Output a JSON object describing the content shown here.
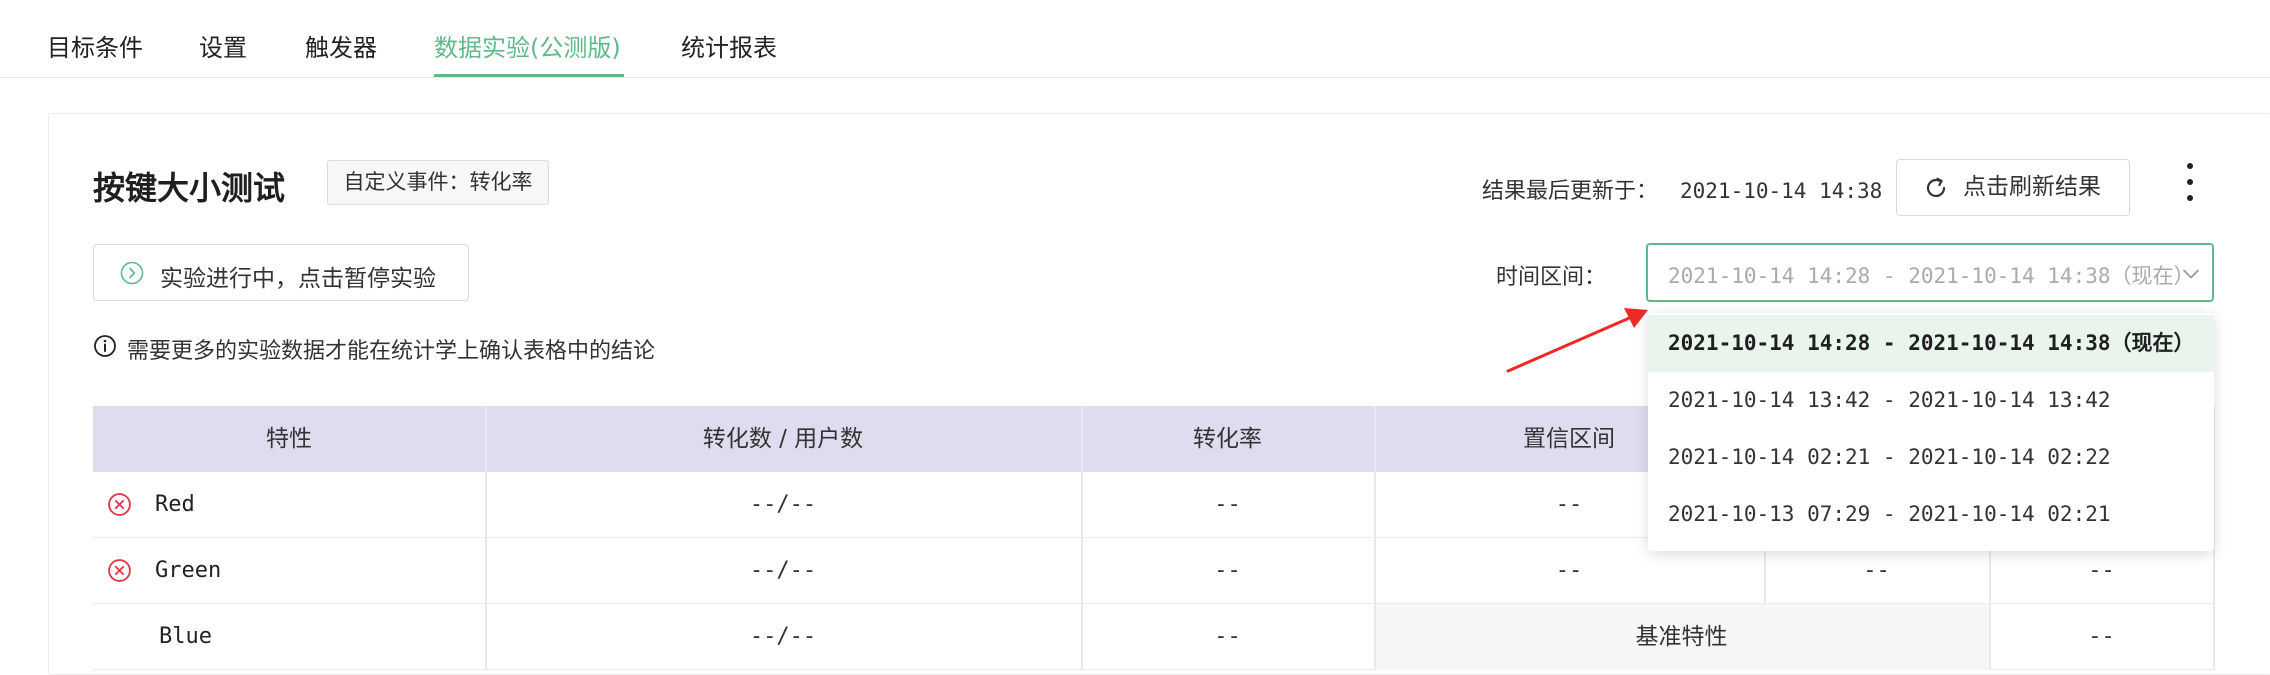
{
  "tabs": [
    {
      "label": "目标条件"
    },
    {
      "label": "设置"
    },
    {
      "label": "触发器"
    },
    {
      "label": "数据实验(公测版)"
    },
    {
      "label": "统计报表"
    }
  ],
  "experiment": {
    "title": "按键大小测试",
    "event_tag": "自定义事件：转化率",
    "updated_label": "结果最后更新于：",
    "updated_time": "2021-10-14 14:38",
    "refresh_label": "点击刷新结果",
    "pause_label": "实验进行中，点击暂停实验",
    "notice": "需要更多的实验数据才能在统计学上确认表格中的结论"
  },
  "time_range": {
    "label": "时间区间：",
    "value": "2021-10-14 14:28 - 2021-10-14 14:38（现在）",
    "options": [
      "2021-10-14 14:28 - 2021-10-14 14:38（现在）",
      "2021-10-14 13:42 - 2021-10-14 13:42",
      "2021-10-14 02:21 - 2021-10-14 02:22",
      "2021-10-13 07:29 - 2021-10-14 02:21"
    ]
  },
  "table": {
    "headers": [
      "特性",
      "转化数 / 用户数",
      "转化率",
      "置信区间"
    ],
    "rows": [
      {
        "name": "Red",
        "conversions": "--/--",
        "rate": "--",
        "interval": "--",
        "col5": "--",
        "col6": "--"
      },
      {
        "name": "Green",
        "conversions": "--/--",
        "rate": "--",
        "interval": "--",
        "col5": "--",
        "col6": "--"
      },
      {
        "name": "Blue",
        "conversions": "--/--",
        "rate": "--",
        "baseline": "基准特性",
        "col6": "--"
      }
    ]
  },
  "colors": {
    "accent": "#5fb98a",
    "table_header": "#deddef",
    "error_icon": "#e0394b",
    "annotation_arrow": "#ee2a24"
  },
  "icons": {
    "refresh": "refresh-icon",
    "more": "more-vertical-icon",
    "play": "play-circle-icon",
    "info": "info-icon",
    "chevron": "chevron-down-icon",
    "error": "close-circle-icon"
  }
}
